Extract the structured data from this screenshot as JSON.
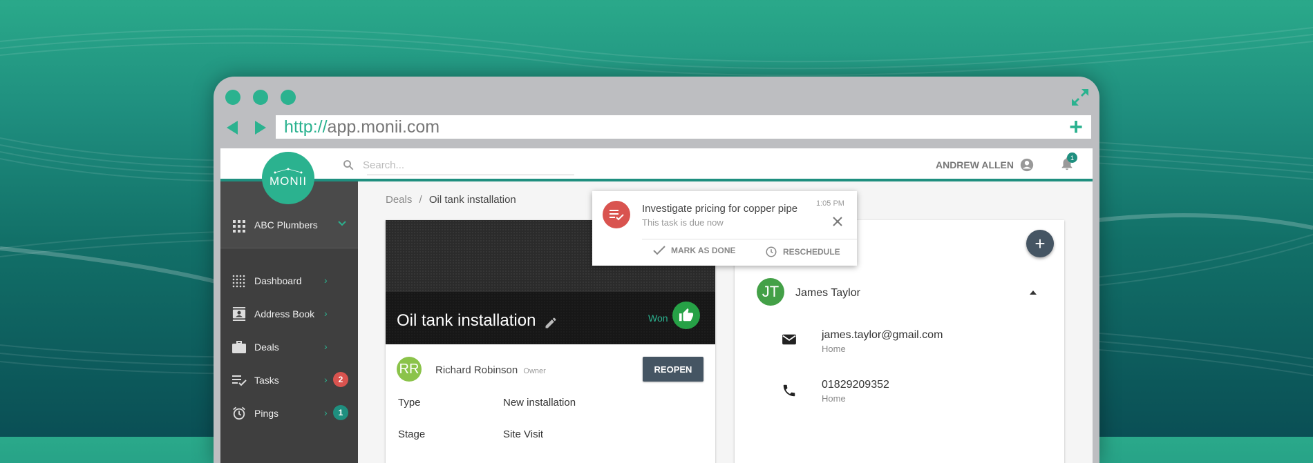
{
  "browser": {
    "url_protocol": "http://",
    "url_host": "app.monii.com"
  },
  "app": {
    "logo_text": "MONII",
    "search_placeholder": "Search...",
    "user_name": "ANDREW ALLEN",
    "notification_count": "1"
  },
  "sidebar": {
    "company": "ABC Plumbers",
    "items": [
      {
        "label": "Dashboard",
        "icon": "dashboard-icon"
      },
      {
        "label": "Address Book",
        "icon": "address-book-icon"
      },
      {
        "label": "Deals",
        "icon": "briefcase-icon"
      },
      {
        "label": "Tasks",
        "icon": "tasks-icon",
        "badge": "2",
        "badge_color": "#d9534f"
      },
      {
        "label": "Pings",
        "icon": "alarm-icon",
        "badge": "1",
        "badge_color": "#1f8f7f"
      }
    ]
  },
  "breadcrumb": {
    "parent": "Deals",
    "separator": "/",
    "current": "Oil tank installation"
  },
  "deal": {
    "title": "Oil tank installation",
    "status": "Won",
    "owner_initials": "RR",
    "owner_name": "Richard Robinson",
    "owner_role": "Owner",
    "reopen_label": "REOPEN",
    "fields": [
      {
        "label": "Type",
        "value": "New installation"
      },
      {
        "label": "Stage",
        "value": "Site Visit"
      }
    ]
  },
  "contact": {
    "initials": "JT",
    "name": "James Taylor",
    "email": "james.taylor@gmail.com",
    "email_type": "Home",
    "phone": "01829209352",
    "phone_type": "Home"
  },
  "notification": {
    "title": "Investigate pricing for copper pipe",
    "subtitle": "This task is due now",
    "time": "1:05 PM",
    "mark_done_label": "MARK AS DONE",
    "reschedule_label": "RESCHEDULE"
  },
  "colors": {
    "brand": "#2bb28f",
    "dark_teal": "#1f8f7f",
    "sidebar": "#3f3f3f",
    "button_dark": "#455563",
    "danger": "#d9534f",
    "won_green": "#26a146"
  }
}
